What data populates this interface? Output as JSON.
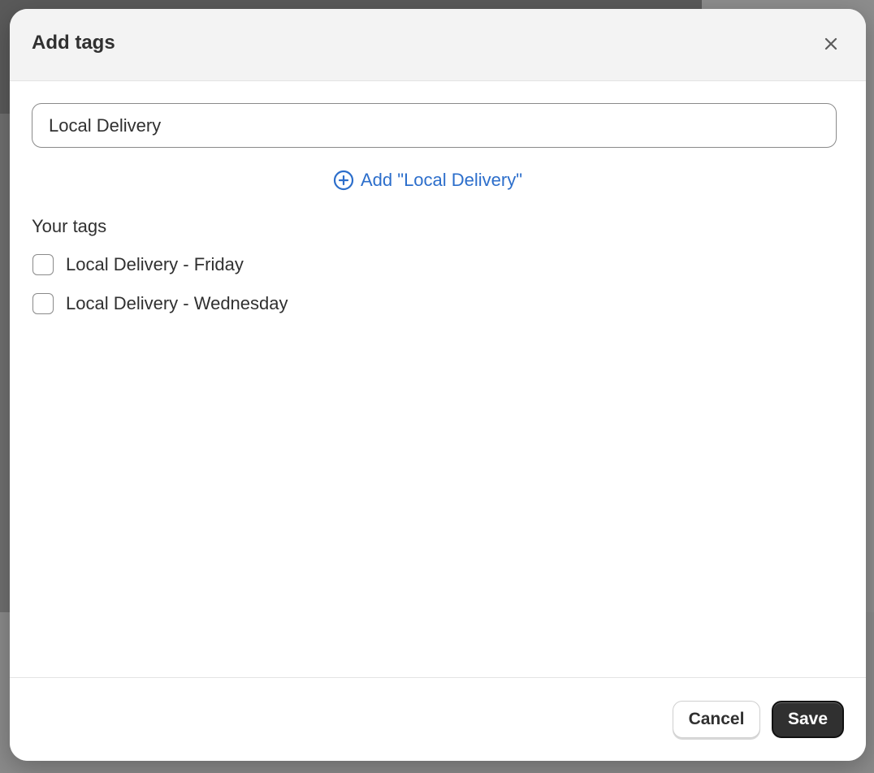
{
  "modal": {
    "title": "Add tags",
    "close_icon": "close-icon"
  },
  "tag_input": {
    "value": "Local Delivery",
    "placeholder": ""
  },
  "add_link": {
    "icon": "plus-circle-icon",
    "label": "Add \"Local Delivery\""
  },
  "your_tags": {
    "label": "Your tags",
    "options": [
      {
        "label": "Local Delivery - Friday",
        "checked": false
      },
      {
        "label": "Local Delivery - Wednesday",
        "checked": false
      }
    ]
  },
  "footer": {
    "cancel_label": "Cancel",
    "save_label": "Save"
  },
  "colors": {
    "accent": "#2c6ecb",
    "primary_button": "#303030",
    "text": "#303030"
  }
}
